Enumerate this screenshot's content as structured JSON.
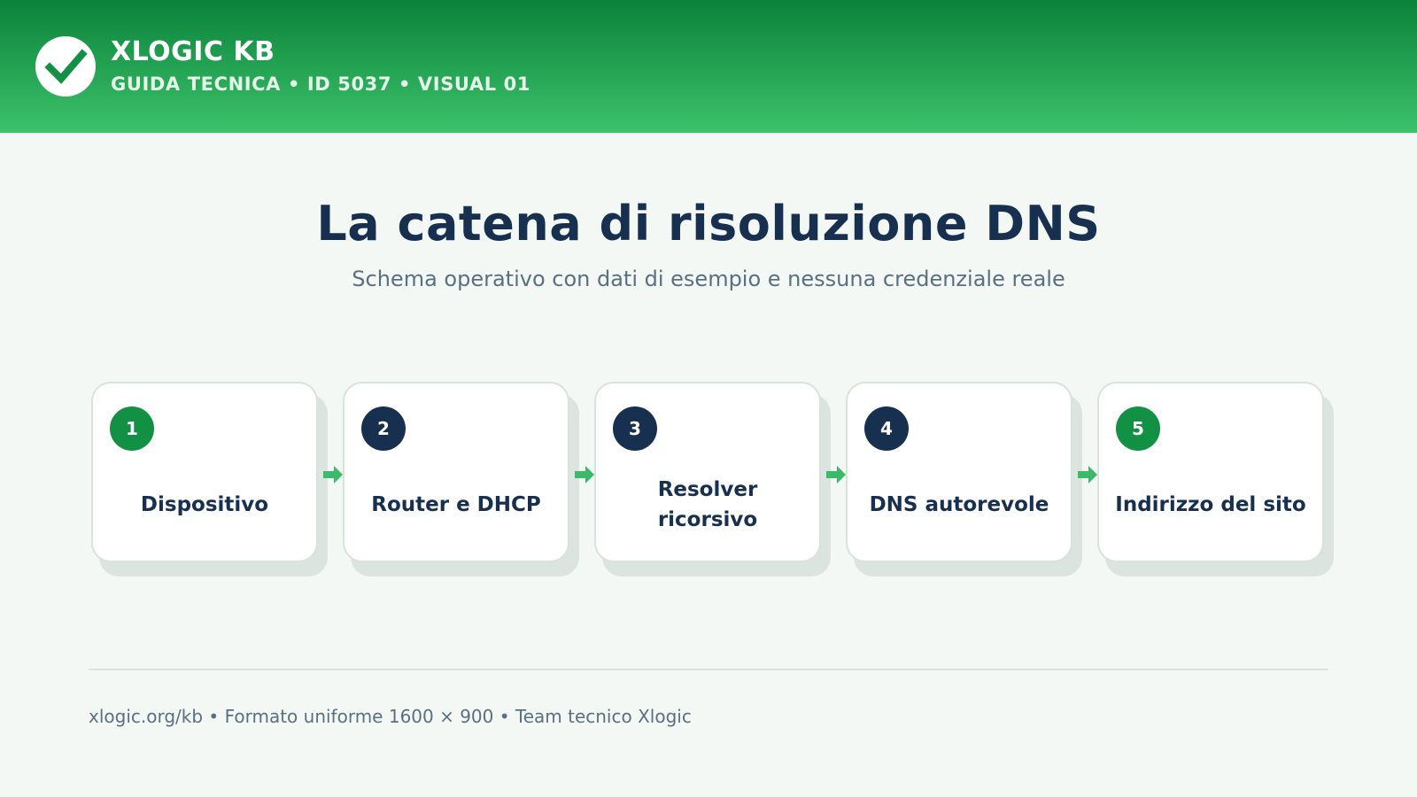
{
  "header": {
    "brand": "XLOGIC KB",
    "subtitle": "GUIDA TECNICA • ID 5037 • VISUAL 01",
    "logo_icon": "check-icon"
  },
  "main": {
    "title": "La catena di risoluzione DNS",
    "subtitle": "Schema operativo con dati di esempio e nessuna credenziale reale"
  },
  "steps": [
    {
      "number": "1",
      "label": "Dispositivo",
      "badge_color": "#129145"
    },
    {
      "number": "2",
      "label": "Router e DHCP",
      "badge_color": "#18304f"
    },
    {
      "number": "3",
      "label": "Resolver ricorsivo",
      "badge_color": "#18304f"
    },
    {
      "number": "4",
      "label": "DNS autorevole",
      "badge_color": "#18304f"
    },
    {
      "number": "5",
      "label": "Indirizzo del sito",
      "badge_color": "#129145"
    }
  ],
  "footer": {
    "text": "xlogic.org/kb • Formato uniforme 1600 × 900 • Team tecnico Xlogic"
  },
  "colors": {
    "header_top": "#0b823a",
    "header_bottom": "#3cc26b",
    "accent_green": "#129145",
    "navy": "#18304f",
    "arrow_green": "#3cb96a",
    "background": "#f3f8f4"
  }
}
